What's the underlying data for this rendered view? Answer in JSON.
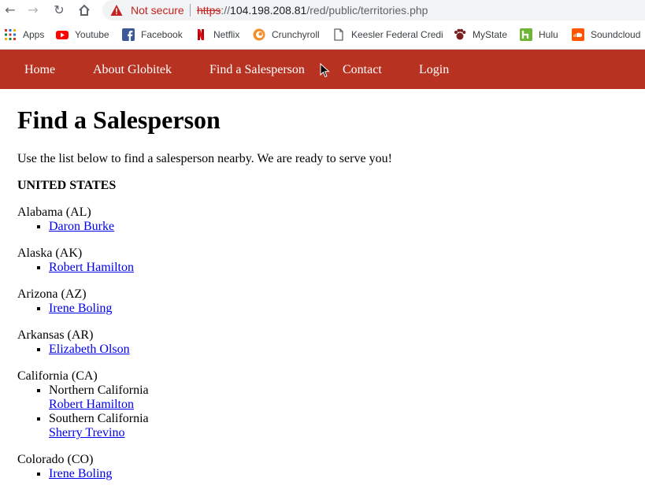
{
  "browser": {
    "security_label": "Not secure",
    "url_scheme": "https",
    "url_host": "104.198.208.81",
    "url_path": "/red/public/territories.php",
    "bookmarks": [
      {
        "label": "Apps",
        "icon": "apps-grid-icon"
      },
      {
        "label": "Youtube",
        "icon": "youtube-icon",
        "color": "#ff0000"
      },
      {
        "label": "Facebook",
        "icon": "facebook-icon",
        "color": "#3b5998"
      },
      {
        "label": "Netflix",
        "icon": "netflix-icon",
        "color": "#e50914"
      },
      {
        "label": "Crunchyroll",
        "icon": "crunchyroll-icon",
        "color": "#f78c25"
      },
      {
        "label": "Keesler Federal Credi",
        "icon": "page-icon"
      },
      {
        "label": "MyState",
        "icon": "mystate-icon",
        "color": "#7a1f1f"
      },
      {
        "label": "Hulu",
        "icon": "hulu-icon",
        "color": "#6fb634"
      },
      {
        "label": "Soundcloud",
        "icon": "soundcloud-icon",
        "color": "#ff5500"
      }
    ]
  },
  "nav": {
    "items": [
      "Home",
      "About Globitek",
      "Find a Salesperson",
      "Contact",
      "Login"
    ],
    "bg_color": "#b83222"
  },
  "page": {
    "title": "Find a Salesperson",
    "intro": "Use the list below to find a salesperson nearby. We are ready to serve you!",
    "country": "UNITED STATES",
    "states": [
      {
        "name": "Alabama (AL)",
        "salespeople": [
          "Daron Burke"
        ]
      },
      {
        "name": "Alaska (AK)",
        "salespeople": [
          "Robert Hamilton"
        ]
      },
      {
        "name": "Arizona (AZ)",
        "salespeople": [
          "Irene Boling"
        ]
      },
      {
        "name": "Arkansas (AR)",
        "salespeople": [
          "Elizabeth Olson"
        ]
      },
      {
        "name": "California (CA)",
        "regions": [
          {
            "region": "Northern California",
            "salesperson": "Robert Hamilton"
          },
          {
            "region": "Southern California",
            "salesperson": "Sherry Trevino"
          }
        ]
      },
      {
        "name": "Colorado (CO)",
        "salespeople": [
          "Irene Boling"
        ]
      }
    ]
  }
}
